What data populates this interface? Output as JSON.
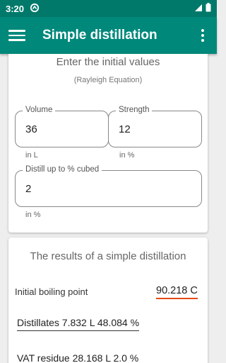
{
  "status_bar": {
    "time": "3:20"
  },
  "app_bar": {
    "title": "Simple distillation"
  },
  "input_card": {
    "heading": "Enter the initial values",
    "subheading": "(Rayleigh Equation)",
    "volume": {
      "label": "Volume",
      "value": "36",
      "unit_hint": "in L"
    },
    "strength": {
      "label": "Strength",
      "value": "12",
      "unit_hint": "in %"
    },
    "distill": {
      "label": "Distill up to % cubed",
      "value": "2",
      "unit_hint": "in %"
    }
  },
  "results_card": {
    "heading": "The results of a simple distillation",
    "initial_boiling_label": "Initial boiling point",
    "initial_boiling_value": "90.218 C",
    "distillates": "Distillates 7.832 L 48.084 %",
    "vat_residue": "VAT residue 28.168 L 2.0 %"
  },
  "colors": {
    "primary": "#00897b",
    "primary_dark": "#00796b",
    "accent": "#e64a19"
  }
}
